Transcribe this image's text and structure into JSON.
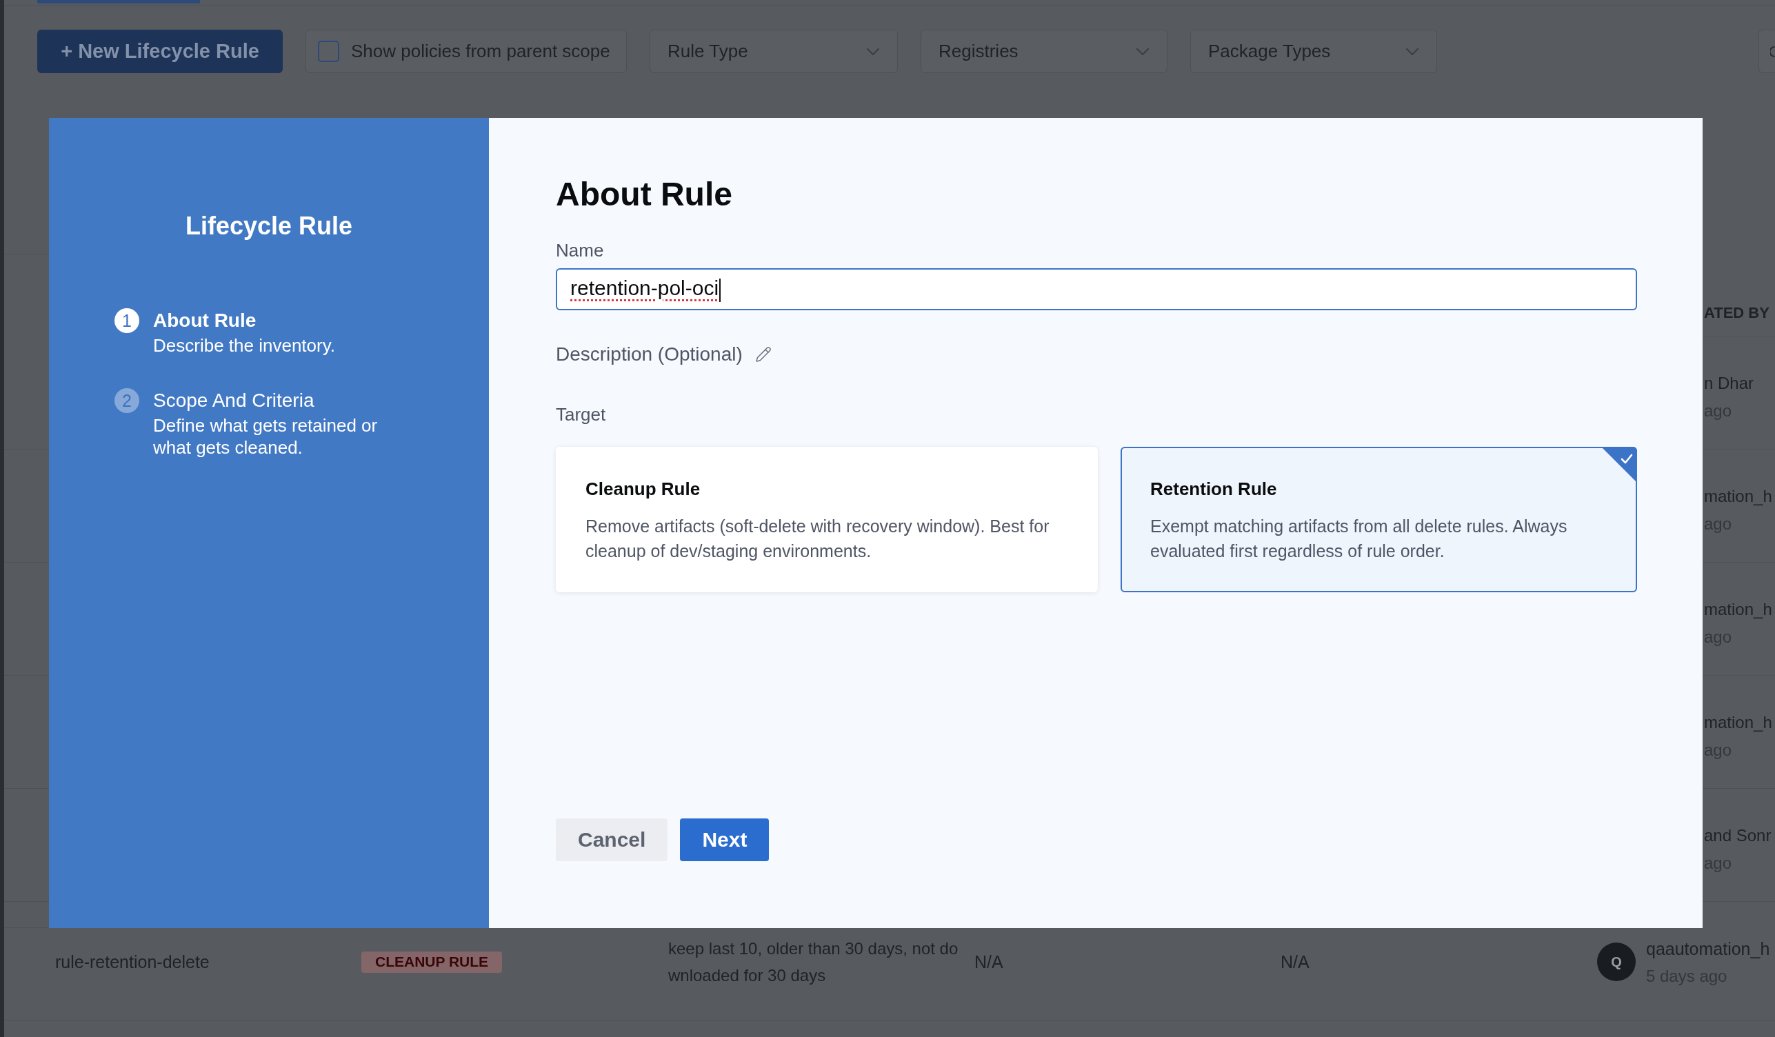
{
  "toolbar": {
    "new_rule_button": "+ New Lifecycle Rule",
    "parent_scope_filter": {
      "label": "Show policies from parent scope",
      "checked": false
    },
    "dropdowns": [
      {
        "label": "Rule Type"
      },
      {
        "label": "Registries"
      },
      {
        "label": "Package Types"
      }
    ]
  },
  "dialog": {
    "sidebar": {
      "title": "Lifecycle Rule",
      "steps": [
        {
          "number": "1",
          "title": "About Rule",
          "description": "Describe the inventory.",
          "selected": true
        },
        {
          "number": "2",
          "title": "Scope And Criteria",
          "description": "Define what gets retained or what gets cleaned.",
          "selected": false
        }
      ]
    },
    "title": "About Rule",
    "name_field": {
      "label": "Name",
      "value": "retention-pol-oci"
    },
    "description_label": "Description (Optional)",
    "target": {
      "label": "Target",
      "options": [
        {
          "title": "Cleanup Rule",
          "description": "Remove artifacts (soft-delete with recovery window). Best for cleanup of dev/staging environments.",
          "selected": false
        },
        {
          "title": "Retention Rule",
          "description": "Exempt matching artifacts from all delete rules. Always evaluated first regardless of rule order.",
          "selected": true
        }
      ]
    },
    "buttons": [
      {
        "label": "Cancel",
        "kind": "secondary"
      },
      {
        "label": "Next",
        "kind": "primary"
      }
    ]
  },
  "background_table": {
    "header_fragment": "ATED BY",
    "column_6_fragments": [
      {
        "name": "n Dhar",
        "time": "ago"
      },
      {
        "name": "mation_h",
        "time": "ago"
      },
      {
        "name": "mation_h",
        "time": "ago"
      },
      {
        "name": "mation_h",
        "time": "ago"
      },
      {
        "name": "and Sonr",
        "time": "ago"
      }
    ],
    "last_row": {
      "column_1": "rule-retention-delete",
      "column_2": "CLEANUP RULE",
      "column_3": "keep last 10, older than 30 days, not downloaded for 30 days",
      "column_4": "N/A",
      "column_5": "N/A",
      "column_6": {
        "initial": "Q",
        "name": "qaautomation_h",
        "time": "5 days ago"
      }
    }
  }
}
